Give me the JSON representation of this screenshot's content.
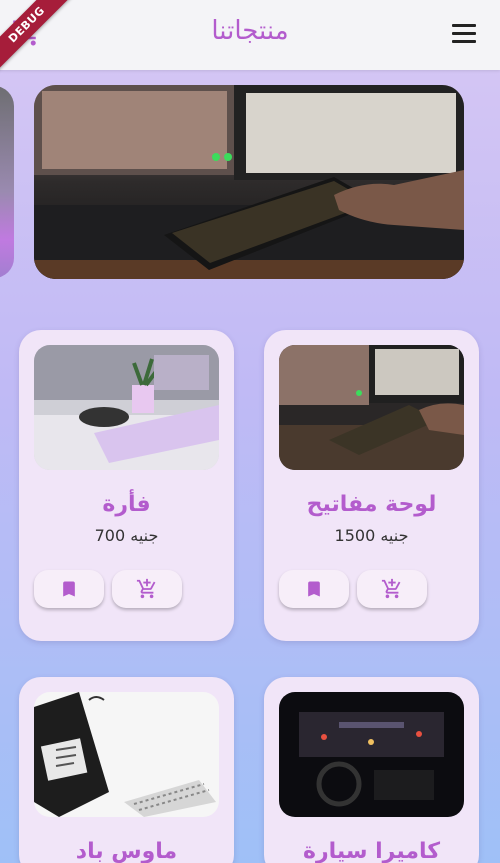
{
  "appbar": {
    "title": "منتجاتنا",
    "debug_label": "DEBUG"
  },
  "colors": {
    "accent": "#b35ccd",
    "card_bg": "#f1e5f8",
    "appbar_bg": "#f4f4f7",
    "debug_red": "#a61d3a"
  },
  "icons": {
    "cart": "add-shopping-cart-icon",
    "menu": "hamburger-menu-icon",
    "bookmark": "bookmark-icon"
  },
  "products": [
    {
      "name": "لوحة مفاتيح",
      "price": "1500 جنيه"
    },
    {
      "name": "فأرة",
      "price": "700 جنيه"
    },
    {
      "name": "كاميرا سيارة",
      "price": ""
    },
    {
      "name": "ماوس باد",
      "price": ""
    }
  ]
}
